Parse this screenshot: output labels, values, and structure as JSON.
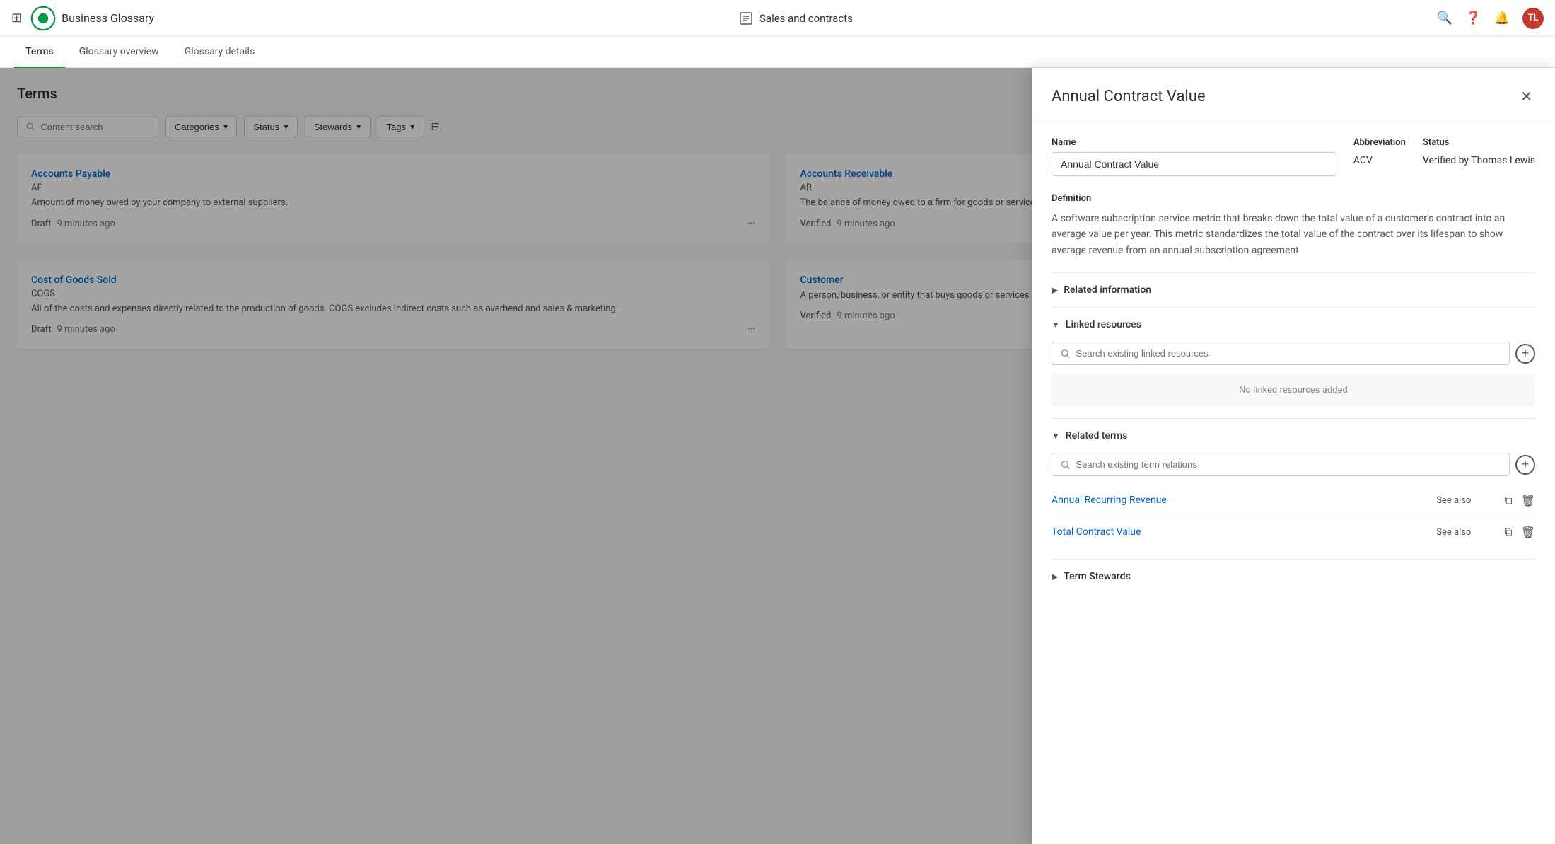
{
  "topNav": {
    "appName": "Business Glossary",
    "centerLabel": "Sales and contracts",
    "avatarInitials": "TL"
  },
  "tabs": [
    {
      "id": "terms",
      "label": "Terms",
      "active": true
    },
    {
      "id": "glossary-overview",
      "label": "Glossary overview",
      "active": false
    },
    {
      "id": "glossary-details",
      "label": "Glossary details",
      "active": false
    }
  ],
  "leftPanel": {
    "title": "Terms",
    "searchPlaceholder": "Content search",
    "filters": [
      {
        "label": "Categories"
      },
      {
        "label": "Status"
      },
      {
        "label": "Stewards"
      },
      {
        "label": "Tags"
      }
    ],
    "terms": [
      {
        "name": "Accounts Payable",
        "abbr": "AP",
        "description": "Amount of money owed by your company to external suppliers.",
        "status": "Draft",
        "time": "9 minutes ago"
      },
      {
        "name": "Accounts Receivable",
        "abbr": "AR",
        "description": "The balance of money owed to a firm for goods or services delivered or used but not yet paid for by customers.",
        "status": "Verified",
        "time": "9 minutes ago"
      },
      {
        "name": "Cost of Goods Sold",
        "abbr": "COGS",
        "description": "All of the costs and expenses directly related to the production of goods. COGS excludes indirect costs such as overhead and sales & marketing.",
        "status": "Draft",
        "time": "9 minutes ago"
      },
      {
        "name": "Customer",
        "abbr": "",
        "description": "A person, business, or entity that buys goods or services from another business. A customer is or has been in an active contract with the organization.",
        "status": "Verified",
        "time": "9 minutes ago"
      }
    ]
  },
  "sidePanel": {
    "title": "Annual Contract Value",
    "fields": {
      "nameLabel": "Name",
      "nameValue": "Annual Contract Value",
      "abbreviationLabel": "Abbreviation",
      "abbreviationValue": "ACV",
      "statusLabel": "Status",
      "statusValue": "Verified by Thomas Lewis"
    },
    "definitionLabel": "Definition",
    "definitionText": "A software subscription service metric that breaks down the total value of a customer's contract into an average value per year. This metric standardizes  the total value of the contract over its lifespan to show average revenue from an annual subscription agreement.",
    "relatedInformation": {
      "label": "Related information",
      "expanded": false
    },
    "linkedResources": {
      "label": "Linked resources",
      "expanded": true,
      "searchPlaceholder": "Search existing linked resources",
      "noResourcesText": "No linked resources added"
    },
    "relatedTerms": {
      "label": "Related terms",
      "expanded": true,
      "searchPlaceholder": "Search existing term relations",
      "terms": [
        {
          "name": "Annual Recurring Revenue",
          "relation": "See also"
        },
        {
          "name": "Total Contract Value",
          "relation": "See also"
        }
      ]
    },
    "termStewards": {
      "label": "Term Stewards",
      "expanded": false
    }
  }
}
